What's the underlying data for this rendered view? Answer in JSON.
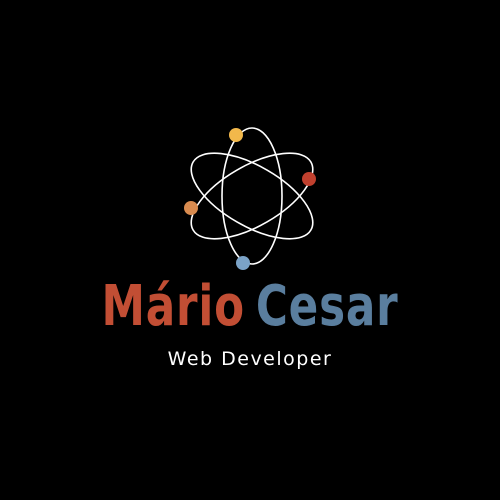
{
  "logo": {
    "icon": "atom-icon",
    "colors": {
      "background": "#000000",
      "orbit": "#ffffff",
      "dot_yellow": "#f2b84b",
      "dot_red": "#c0402e",
      "dot_orange": "#d98b4f",
      "dot_blue": "#7ba3c7"
    }
  },
  "name": {
    "first": "Mário",
    "last": "Cesar",
    "first_color": "#c24e34",
    "last_color": "#5a7e9e"
  },
  "subtitle": "Web Developer"
}
